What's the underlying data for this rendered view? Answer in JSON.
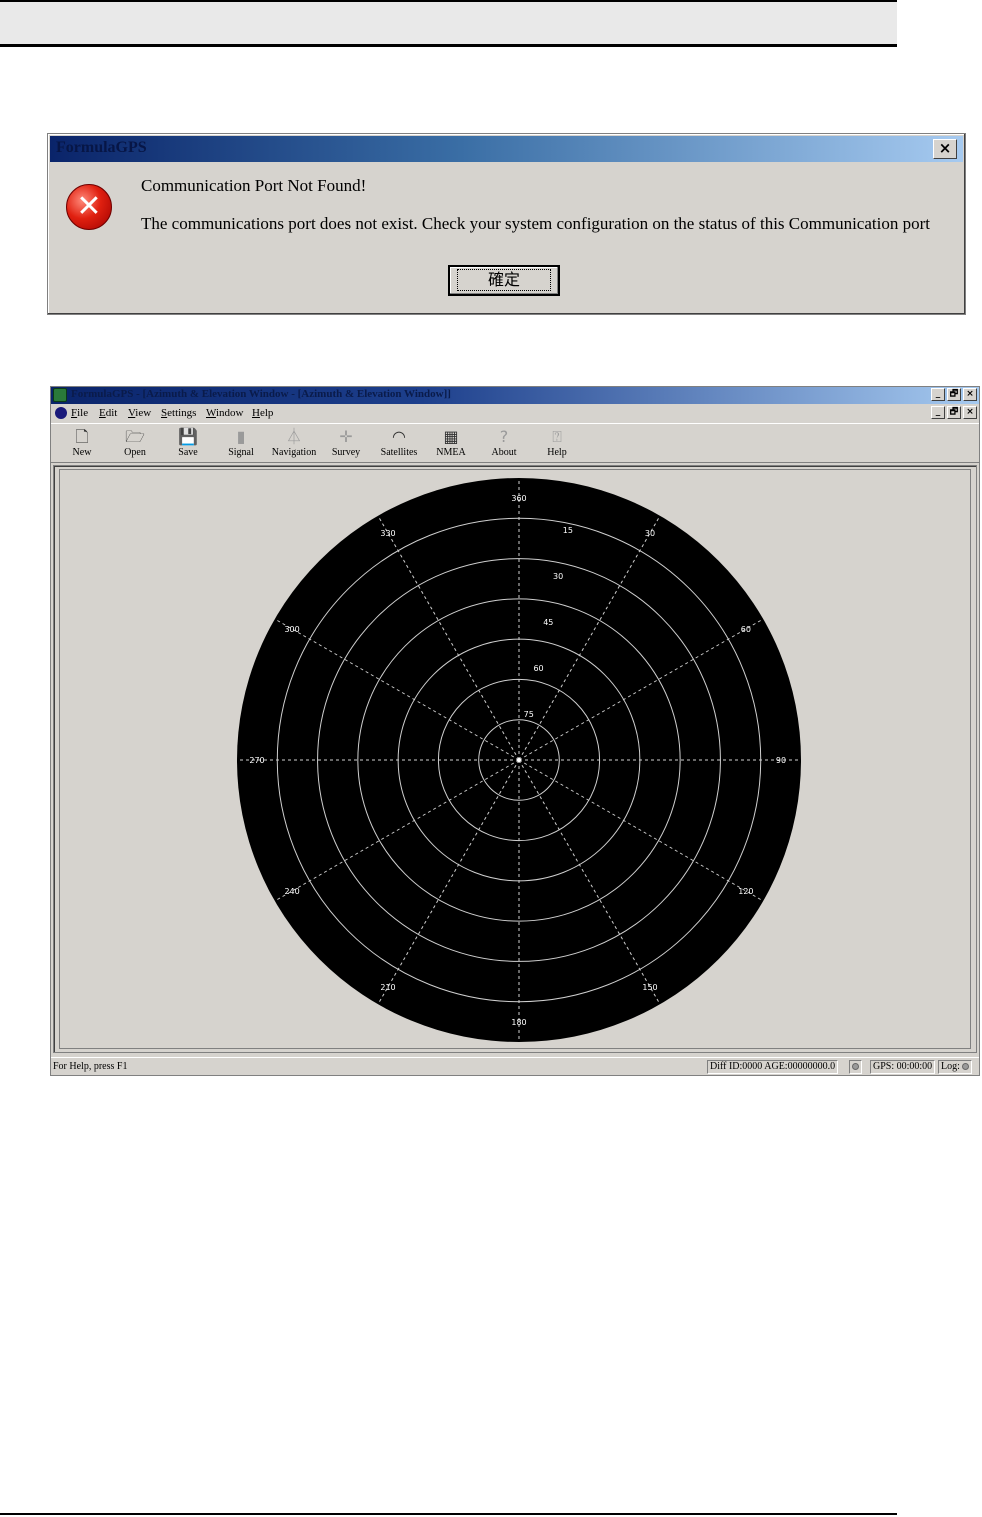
{
  "dialog": {
    "title": "FormulaGPS",
    "close_glyph": "×",
    "icon": "error-icon",
    "icon_glyph": "✕",
    "heading": "Communication Port Not Found!",
    "message": "The communications port does not exist. Check your system configuration on the status of this Communication port",
    "ok_label": "確定"
  },
  "app": {
    "title": "FormulaGPS - [Azimuth & Elevation Window - [Azimuth & Elevation Window]]",
    "window_controls": [
      "_",
      "🗗",
      "×"
    ],
    "menu": [
      {
        "accel": "F",
        "rest": "ile"
      },
      {
        "accel": "E",
        "rest": "dit"
      },
      {
        "accel": "V",
        "rest": "iew"
      },
      {
        "accel": "S",
        "rest": "ettings"
      },
      {
        "accel": "W",
        "rest": "indow"
      },
      {
        "accel": "H",
        "rest": "elp"
      }
    ],
    "toolbar": [
      {
        "label": "New",
        "icon": "new-file-icon",
        "glyph": "🗋"
      },
      {
        "label": "Open",
        "icon": "open-folder-icon",
        "glyph": "🗁"
      },
      {
        "label": "Save",
        "icon": "save-disk-icon",
        "glyph": "💾"
      },
      {
        "label": "Signal",
        "icon": "signal-bars-icon",
        "glyph": "▮"
      },
      {
        "label": "Navigation",
        "icon": "compass-icon",
        "glyph": "⏃"
      },
      {
        "label": "Survey",
        "icon": "crosshair-icon",
        "glyph": "✛"
      },
      {
        "label": "Satellites",
        "icon": "satellite-dish-icon",
        "glyph": "◠"
      },
      {
        "label": "NMEA",
        "icon": "nmea-grid-icon",
        "glyph": "▦"
      },
      {
        "label": "About",
        "icon": "question-icon",
        "glyph": "?"
      },
      {
        "label": "Help",
        "icon": "help-pointer-icon",
        "glyph": "⍰"
      }
    ],
    "status": {
      "help_text": "For Help, press F1",
      "diff": "Diff ID:0000 AGE:00000000.0",
      "gps": "GPS: 00:00:00",
      "log": "Log:"
    }
  },
  "polar_plot": {
    "background": "#000000",
    "grid_color": "#cfcfcf",
    "azimuth_labels": [
      "360",
      "30",
      "60",
      "90",
      "120",
      "150",
      "180",
      "210",
      "240",
      "270",
      "300",
      "330"
    ],
    "elevation_labels": [
      "15",
      "30",
      "45",
      "60",
      "75"
    ]
  }
}
